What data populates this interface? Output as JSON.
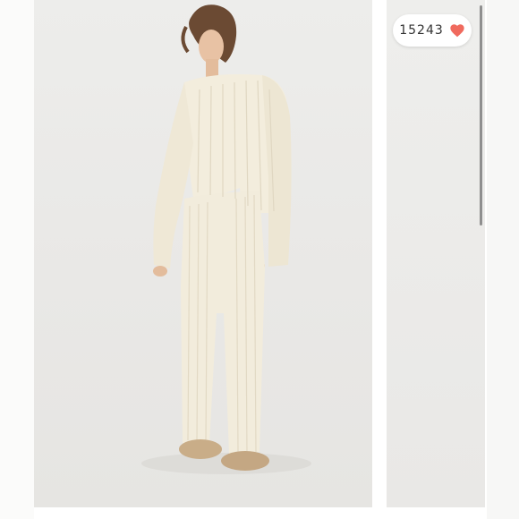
{
  "listing": {
    "photo": {
      "subject": "model-in-cream-ribbed-knit-set",
      "background_color": "#ebeae8",
      "garment_color": "#f2ecdc",
      "shoe_color": "#c9ad88"
    },
    "likes": {
      "count": "15243",
      "icon": "heart-icon",
      "icon_color": "#f06a5e"
    }
  }
}
